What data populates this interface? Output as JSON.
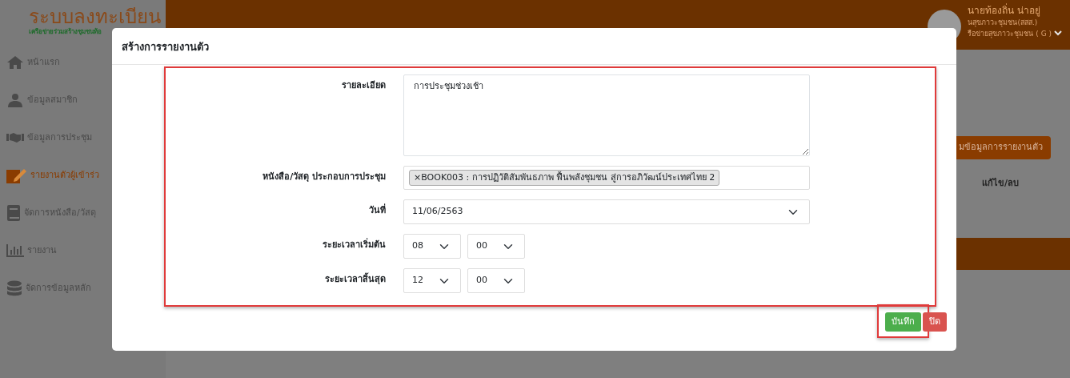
{
  "app": {
    "title": "ระบบลงทะเบียน",
    "subtitle": "เครือข่ายร่วมสร้างชุมชนท้อ"
  },
  "sidebar": {
    "items": [
      {
        "label": "หน้าแรก",
        "kind": "home",
        "selected": false
      },
      {
        "label": "ข้อมูลสมาชิก",
        "kind": "members",
        "selected": false
      },
      {
        "label": "ข้อมูลการประชุม",
        "kind": "meeting",
        "selected": false
      },
      {
        "label": "รายงานตัวผู้เข้าร่ว",
        "kind": "report",
        "selected": true
      },
      {
        "label": "จัดการหนังสือ/วัสดุ",
        "kind": "book",
        "selected": false
      },
      {
        "label": "รายงาน",
        "kind": "chart",
        "selected": false
      },
      {
        "label": "จัดการข้อมูลหลัก",
        "kind": "database",
        "selected": false
      }
    ]
  },
  "user": {
    "name": "นายท้องถิ่น น่าอยู่",
    "lines": [
      "นสุขภาวะชุมชน(สสส.)",
      "รือข่ายสุขภาวะชุมชน ( G )"
    ]
  },
  "background": {
    "button": "มข้อมูลการรายงานตัว",
    "column": "แก้ไข/ลบ"
  },
  "modal": {
    "title": "สร้างการรายงานตัว",
    "fields": [
      {
        "kind": "textarea",
        "label": "รายละเอียด",
        "value": "การประชุมช่วงเช้า"
      },
      {
        "kind": "tags",
        "label": "หนังสือ/วัสดุ ประกอบการประชุม",
        "remove": "×",
        "tags": [
          "BOOK003 : การปฏิวัติสัมพันธภาพ ฟื้นพลังชุมชน สู่การอภิวัฒน์ประเทศไทย 2"
        ]
      },
      {
        "kind": "select",
        "label": "วันที่",
        "value": "11/06/2563"
      },
      {
        "kind": "time",
        "label": "ระยะเวลาเริ่มต้น",
        "hour": "08",
        "minute": "00"
      },
      {
        "kind": "time",
        "label": "ระยะเวลาสิ้นสุด",
        "hour": "12",
        "minute": "00"
      }
    ],
    "buttons": [
      {
        "kind": "save",
        "label": "บันทึก"
      },
      {
        "kind": "close",
        "label": "ปิด"
      }
    ]
  }
}
